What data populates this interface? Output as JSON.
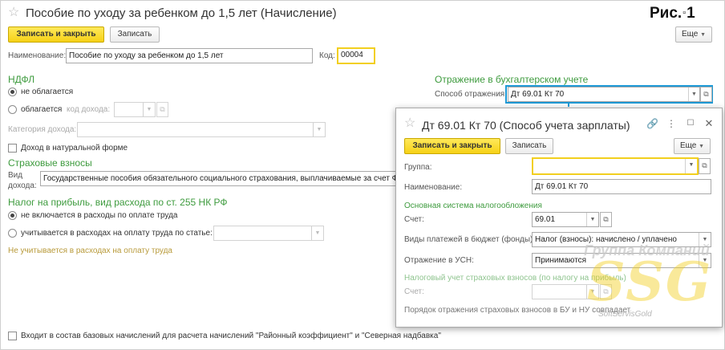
{
  "main": {
    "title": "Пособие по уходу за ребенком до 1,5 лет (Начисление)",
    "fig_label": "Рис.",
    "fig_num": "1",
    "save_close": "Записать и закрыть",
    "save": "Записать",
    "more": "Еще",
    "name_label": "Наименование:",
    "name_value": "Пособие по уходу за ребенком до 1,5 лет",
    "code_label": "Код:",
    "code_value": "00004",
    "ndfl_title": "НДФЛ",
    "ndfl_opt1": "не облагается",
    "ndfl_opt2": "облагается",
    "income_code_label": "код дохода:",
    "income_category_label": "Категория дохода:",
    "in_kind_label": "Доход в натуральной форме",
    "acc_title": "Отражение в бухгалтерском учете",
    "acc_method_label": "Способ отражения:",
    "acc_method_value": "Дт 69.01 Кт 70",
    "ins_title": "Страховые взносы",
    "income_type_label_1": "Вид",
    "income_type_label_2": "дохода:",
    "income_type_value": "Государственные пособия обязательного социального страхования, выплачиваемые за счет ФСС",
    "profit_title": "Налог на прибыль, вид расхода по ст. 255 НК РФ",
    "profit_opt1": "не включается в расходы по оплате труда",
    "profit_opt2": "учитывается в расходах на оплату труда по статье:",
    "profit_note": "Не учитывается в расходах на оплату труда",
    "base_label": "Входит в состав базовых начислений для расчета начислений \"Районный коэффициент\" и \"Северная надбавка\""
  },
  "popup": {
    "title": "Дт 69.01 Кт 70 (Способ учета зарплаты)",
    "save_close": "Записать и закрыть",
    "save": "Записать",
    "more": "Еще",
    "group_label": "Группа:",
    "group_value": "",
    "name_label": "Наименование:",
    "name_value": "Дт 69.01 Кт 70",
    "tax_system_title": "Основная система налогообложения",
    "account_label": "Счет:",
    "account_value": "69.01",
    "payment_types_label": "Виды платежей в бюджет (фонды):",
    "payment_types_value": "Налог (взносы): начислено / уплачено",
    "usn_label": "Отражение в УСН:",
    "usn_value": "Принимаются",
    "tax_ins_title": "Налоговый учет страховых взносов (по налогу на прибыль)",
    "tax_account_label": "Счет:",
    "order_note": "Порядок отражения страховых взносов в БУ и НУ совпадает"
  },
  "watermark": {
    "line1": "Группа Компаний",
    "big": "SSG",
    "small": "SoftServisGold"
  },
  "colors": {
    "primary_button": "#f6d117",
    "section_green": "#3e9b3e",
    "highlight_blue": "#1e9ad6",
    "highlight_yellow": "#f2cf1f"
  }
}
